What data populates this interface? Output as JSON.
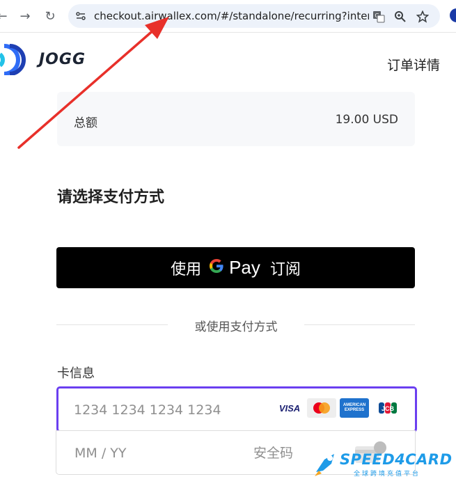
{
  "browser": {
    "url": "checkout.airwallex.com/#/standalone/recurring?intent_i...",
    "icons": [
      "back-icon",
      "forward-icon",
      "reload-icon",
      "site-info-icon",
      "translate-icon",
      "zoom-icon",
      "bookmark-star-icon"
    ]
  },
  "header": {
    "logo_text": "JOGG",
    "order_details": "订单详情"
  },
  "summary": {
    "total_label": "总额",
    "total_amount": "19.00 USD"
  },
  "payment": {
    "section_title": "请选择支付方式",
    "gpay_prefix": "使用",
    "gpay_brand": "Pay",
    "gpay_suffix": "订阅",
    "divider_text": "或使用支付方式",
    "card_label": "卡信息",
    "card_number_placeholder": "1234 1234 1234 1234",
    "card_brands": [
      "VISA",
      "Mastercard",
      "AMERICAN EXPRESS",
      "JCB"
    ],
    "expiry_placeholder": "MM / YY",
    "cvc_placeholder": "安全码",
    "cvc_badge": "123"
  },
  "watermark": {
    "brand": "SPEED4CARD",
    "sub": "全球跨境充值平台"
  },
  "colors": {
    "focus_border": "#6b3ff0",
    "annotation_arrow": "#e8302a",
    "watermark": "#1e9be8"
  }
}
